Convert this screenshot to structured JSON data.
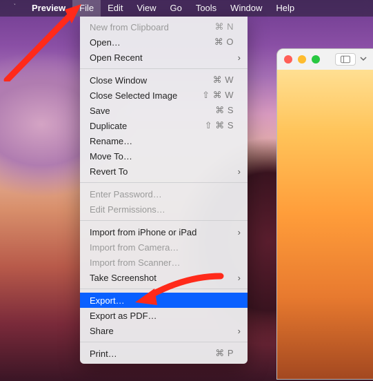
{
  "menubar": {
    "app": "Preview",
    "items": [
      "File",
      "Edit",
      "View",
      "Go",
      "Tools",
      "Window",
      "Help"
    ],
    "open_index": 0
  },
  "menu": {
    "groups": [
      [
        {
          "label": "New from Clipboard",
          "shortcut": "⌘ N",
          "disabled": true
        },
        {
          "label": "Open…",
          "shortcut": "⌘ O"
        },
        {
          "label": "Open Recent",
          "submenu": true
        }
      ],
      [
        {
          "label": "Close Window",
          "shortcut": "⌘ W"
        },
        {
          "label": "Close Selected Image",
          "shortcut": "⇧ ⌘ W"
        },
        {
          "label": "Save",
          "shortcut": "⌘ S"
        },
        {
          "label": "Duplicate",
          "shortcut": "⇧ ⌘ S"
        },
        {
          "label": "Rename…"
        },
        {
          "label": "Move To…"
        },
        {
          "label": "Revert To",
          "submenu": true
        }
      ],
      [
        {
          "label": "Enter Password…",
          "disabled": true
        },
        {
          "label": "Edit Permissions…",
          "disabled": true
        }
      ],
      [
        {
          "label": "Import from iPhone or iPad",
          "submenu": true
        },
        {
          "label": "Import from Camera…",
          "disabled": true
        },
        {
          "label": "Import from Scanner…",
          "disabled": true
        },
        {
          "label": "Take Screenshot",
          "submenu": true
        }
      ],
      [
        {
          "label": "Export…",
          "highlight": true
        },
        {
          "label": "Export as PDF…"
        },
        {
          "label": "Share",
          "submenu": true
        }
      ],
      [
        {
          "label": "Print…",
          "shortcut": "⌘ P"
        }
      ]
    ]
  },
  "icons": {
    "chevron": "›"
  }
}
